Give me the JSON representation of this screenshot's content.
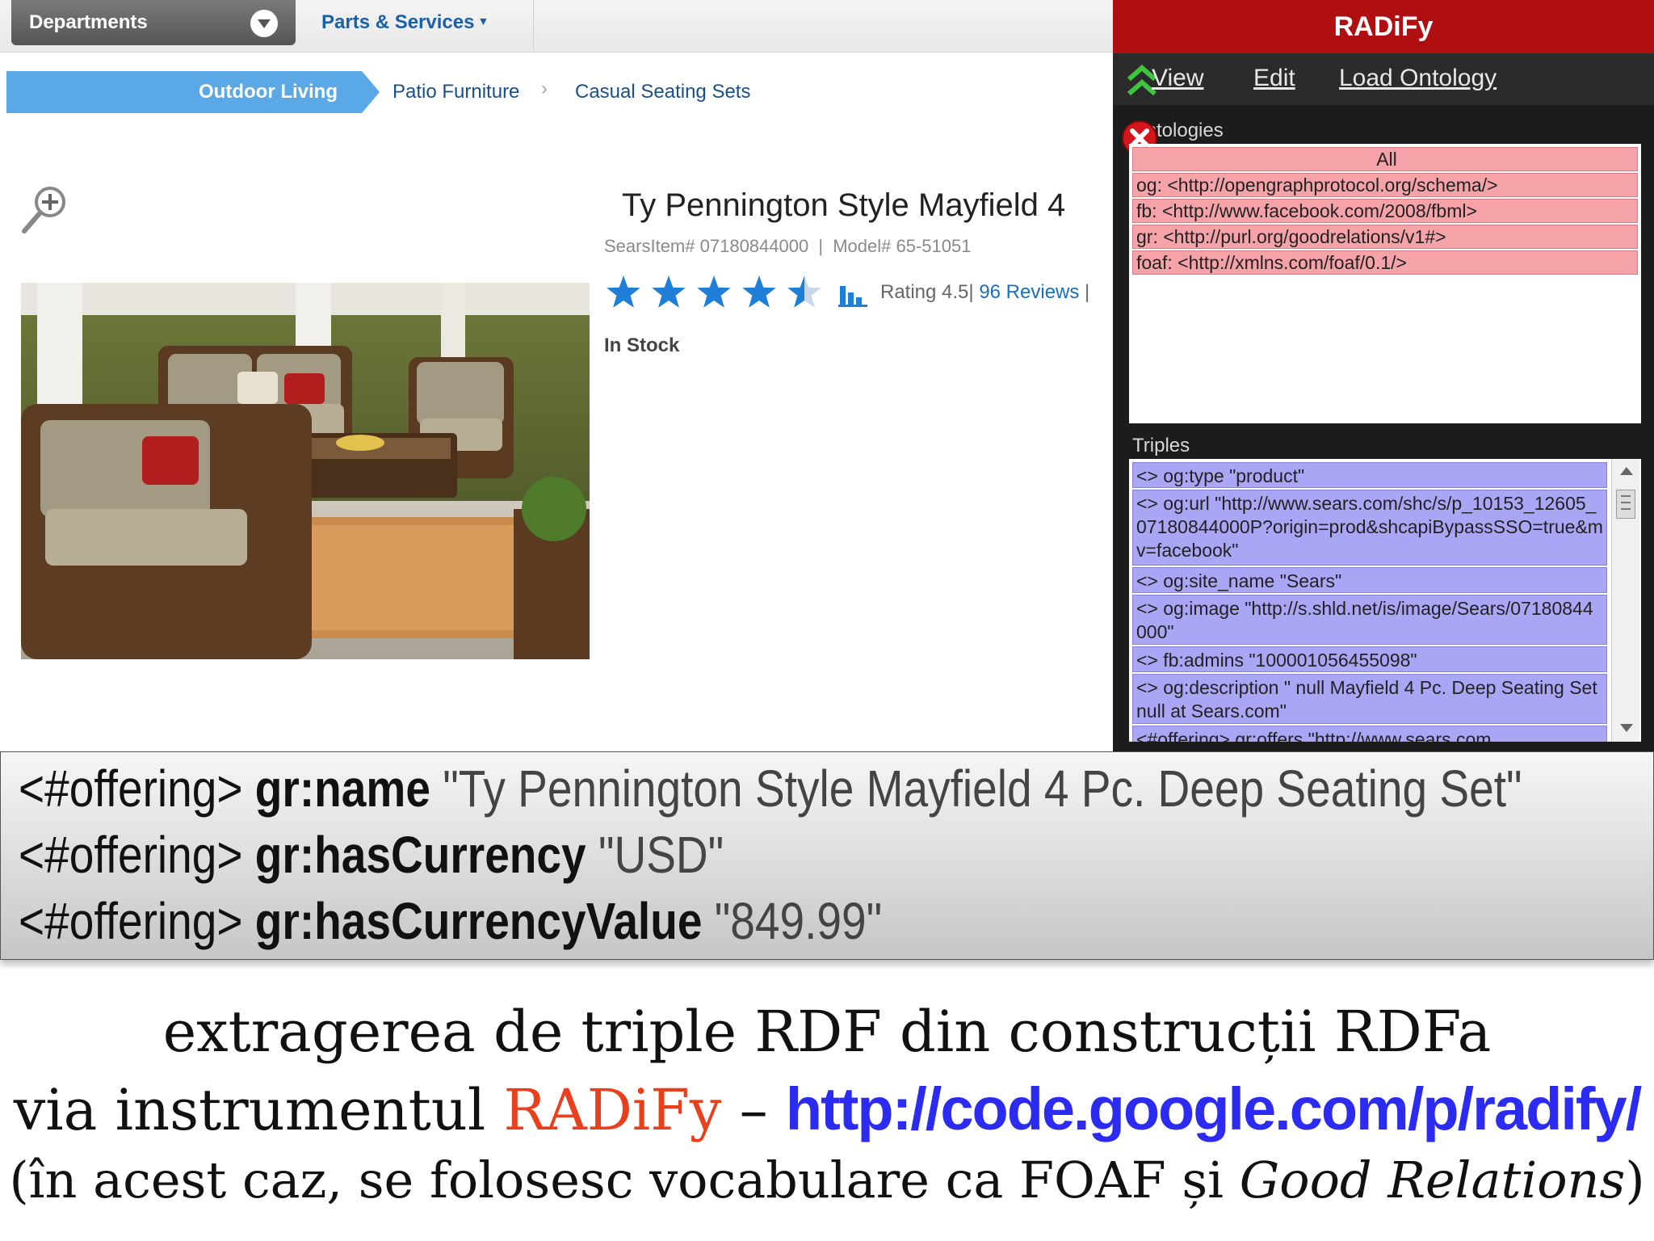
{
  "sears": {
    "departments_label": "Departments",
    "parts_label": "Parts & Services",
    "breadcrumbs": [
      "Outdoor Living",
      "Patio Furniture",
      "Casual Seating Sets"
    ],
    "breadcrumb_sep": "›",
    "product": {
      "title": "Ty Pennington Style  Mayfield 4",
      "searsitem_label": "SearsItem#",
      "searsitem": "07180844000",
      "model_label": "Model#",
      "model": "65-51051",
      "meta_sep": "|",
      "rating_label": "Rating 4.5|",
      "rating_value": 4.5,
      "reviews_link": "96 Reviews",
      "rating_tail": "|",
      "stock": "In Stock"
    }
  },
  "radify": {
    "title": "RADiFy",
    "menu": [
      "View",
      "Edit",
      "Load Ontology"
    ],
    "ontologies_label": "Ontologies",
    "ontologies": [
      "All",
      "og: <http://opengraphprotocol.org/schema/>",
      "fb: <http://www.facebook.com/2008/fbml>",
      "gr: <http://purl.org/goodrelations/v1#>",
      "foaf: <http://xmlns.com/foaf/0.1/>"
    ],
    "triples_label": "Triples",
    "triples": [
      "<> og:type \"product\"",
      "<> og:url \"http://www.sears.com/shc/s/p_10153_12605_07180844000P?origin=prod&shcapiBypassSSO=true&mv=facebook\"",
      "<> og:site_name \"Sears\"",
      "<> og:image \"http://s.shld.net/is/image/Sears/07180844000\"",
      "<> fb:admins \"100001056455098\"",
      "<> og:description \" null Mayfield 4 Pc. Deep Seating Set null at Sears.com\"",
      "<#offering> gr:offers \"http://www.sears.com"
    ]
  },
  "summary": [
    {
      "subject": "<#offering>",
      "predicate": "gr:name",
      "object": "\"Ty Pennington Style Mayfield 4 Pc. Deep Seating Set\""
    },
    {
      "subject": "<#offering>",
      "predicate": "gr:hasCurrency",
      "object": "\"USD\""
    },
    {
      "subject": "<#offering>",
      "predicate": "gr:hasCurrencyValue",
      "object": "\"849.99\""
    }
  ],
  "caption": {
    "line1": "extragerea de triple RDF din construcții RDFa",
    "line2_prefix": "via instrumentul ",
    "line2_brand": "RADiFy",
    "line2_dash": " – ",
    "line2_url": "http://code.google.com/p/radify/",
    "line3_open": "(în acest caz, se folosesc vocabulare ca FOAF și ",
    "line3_italic": "Good Relations",
    "line3_close": ")"
  },
  "colors": {
    "radify_header": "#b00f12",
    "ontology_row": "#f5a3a8",
    "triple_row": "#a9a6f5",
    "breadcrumb_active": "#5aa8e6",
    "caption_brand": "#e8401c",
    "caption_url": "#2b2bf2"
  },
  "icons": [
    "chevron-down-icon",
    "zoom-in-icon",
    "star-icon",
    "bar-chart-icon",
    "double-chevron-up-icon",
    "close-icon",
    "scroll-up-icon",
    "scroll-down-icon"
  ]
}
